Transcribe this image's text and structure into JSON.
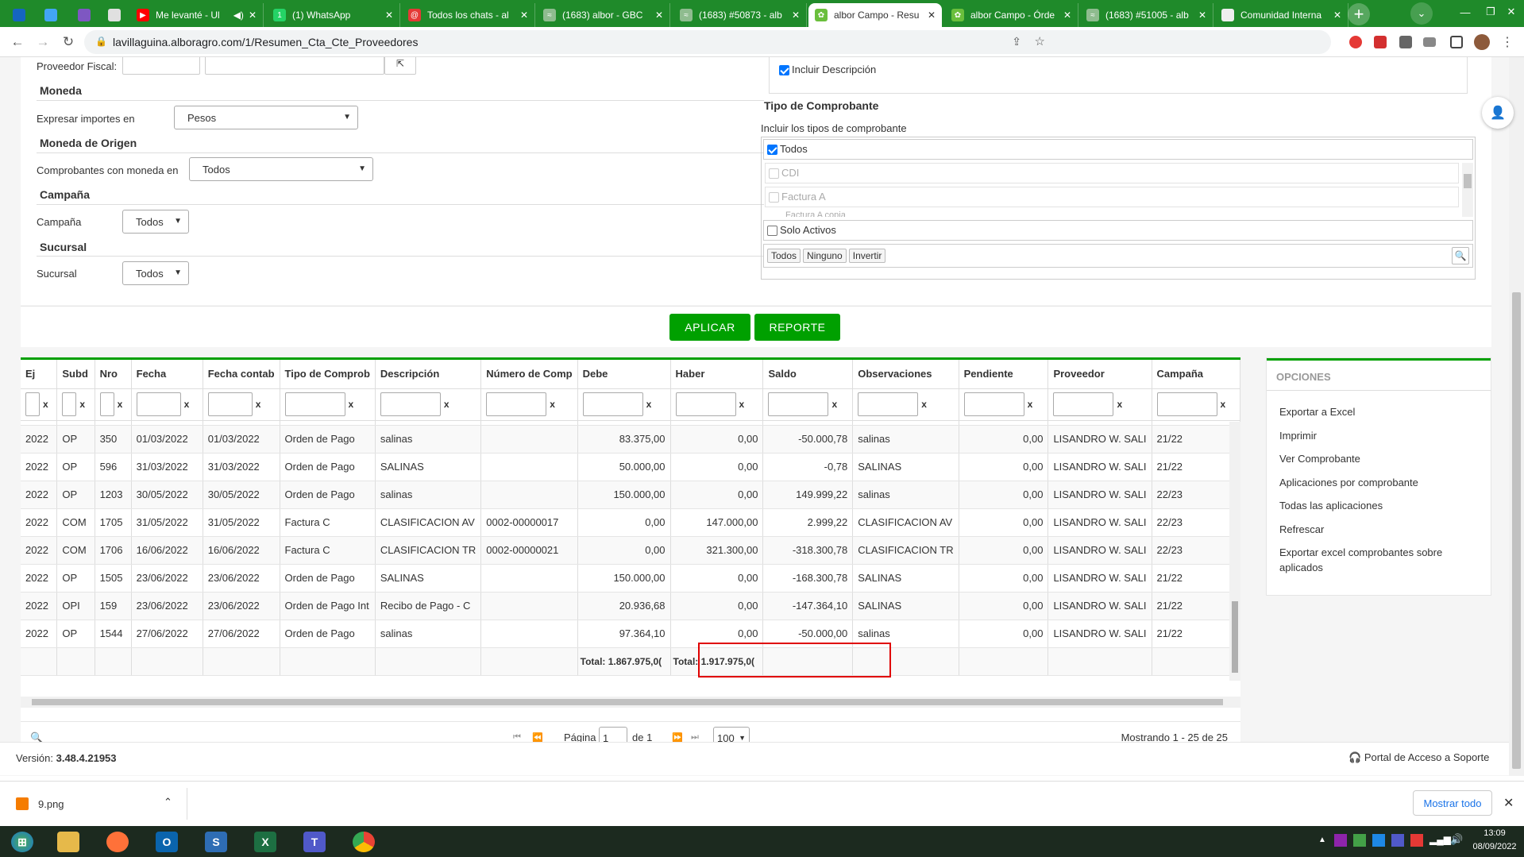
{
  "browser": {
    "tabs": [
      {
        "title": "Me levanté - Ul",
        "fav": "#ff0000",
        "glyph": "▶",
        "extra": "◀)"
      },
      {
        "title": "(1) WhatsApp",
        "fav": "#25d366",
        "glyph": "1"
      },
      {
        "title": "Todos los chats - al",
        "fav": "#e53935",
        "glyph": "@"
      },
      {
        "title": "(1683) albor - GBC",
        "fav": "#8fbc8f",
        "glyph": "≈"
      },
      {
        "title": "(1683) #50873 - alb",
        "fav": "#8fbc8f",
        "glyph": "≈"
      },
      {
        "title": "albor Campo - Resu",
        "fav": "#6abf3c",
        "glyph": "✿",
        "active": true
      },
      {
        "title": "albor Campo - Órde",
        "fav": "#6abf3c",
        "glyph": "✿"
      },
      {
        "title": "(1683) #51005 - alb",
        "fav": "#8fbc8f",
        "glyph": "≈"
      },
      {
        "title": "Comunidad Interna",
        "fav": "#eeeeee",
        "glyph": ""
      }
    ],
    "url": "lavillaguina.alboragro.com/1/Resumen_Cta_Cte_Proveedores"
  },
  "form": {
    "proveedor_fiscal_label": "Proveedor Fiscal:",
    "incluir_descripcion": "Incluir Descripción",
    "moneda_title": "Moneda",
    "expresar_label": "Expresar importes en",
    "expresar_value": "Pesos",
    "moneda_origen_title": "Moneda de Origen",
    "comprobantes_label": "Comprobantes con moneda en",
    "comprobantes_value": "Todos",
    "campana_title": "Campaña",
    "campana_label": "Campaña",
    "campana_value": "Todos",
    "sucursal_title": "Sucursal",
    "sucursal_label": "Sucursal",
    "sucursal_value": "Todos",
    "tipo_title": "Tipo de Comprobante",
    "tipo_subtitle": "Incluir los tipos de comprobante",
    "todos_check": "Todos",
    "tipo_options": [
      "CDI",
      "Factura A",
      "Factura A copia"
    ],
    "solo_activos": "Solo Activos",
    "btn_todos": "Todos",
    "btn_ninguno": "Ninguno",
    "btn_invertir": "Invertir",
    "aplicar": "APLICAR",
    "reporte": "REPORTE"
  },
  "grid": {
    "columns": [
      "Ej",
      "Subd",
      "Nro",
      "Fecha",
      "Fecha contab",
      "Tipo de Comprob",
      "Descripción",
      "Número de Comp",
      "Debe",
      "Haber",
      "Saldo",
      "Observaciones",
      "Pendiente",
      "Proveedor",
      "Campaña"
    ],
    "filter_x": "x",
    "rows": [
      [
        "2022",
        "OP",
        "350",
        "01/03/2022",
        "01/03/2022",
        "Orden de Pago",
        "salinas",
        "",
        "83.375,00",
        "0,00",
        "-50.000,78",
        "salinas",
        "0,00",
        "LISANDRO W. SALI",
        "21/22"
      ],
      [
        "2022",
        "OP",
        "596",
        "31/03/2022",
        "31/03/2022",
        "Orden de Pago",
        "SALINAS",
        "",
        "50.000,00",
        "0,00",
        "-0,78",
        "SALINAS",
        "0,00",
        "LISANDRO W. SALI",
        "21/22"
      ],
      [
        "2022",
        "OP",
        "1203",
        "30/05/2022",
        "30/05/2022",
        "Orden de Pago",
        "salinas",
        "",
        "150.000,00",
        "0,00",
        "149.999,22",
        "salinas",
        "0,00",
        "LISANDRO W. SALI",
        "22/23"
      ],
      [
        "2022",
        "COM",
        "1705",
        "31/05/2022",
        "31/05/2022",
        "Factura C",
        "CLASIFICACION AV",
        "0002-00000017",
        "0,00",
        "147.000,00",
        "2.999,22",
        "CLASIFICACION AV",
        "0,00",
        "LISANDRO W. SALI",
        "22/23"
      ],
      [
        "2022",
        "COM",
        "1706",
        "16/06/2022",
        "16/06/2022",
        "Factura C",
        "CLASIFICACION TR",
        "0002-00000021",
        "0,00",
        "321.300,00",
        "-318.300,78",
        "CLASIFICACION TR",
        "0,00",
        "LISANDRO W. SALI",
        "22/23"
      ],
      [
        "2022",
        "OP",
        "1505",
        "23/06/2022",
        "23/06/2022",
        "Orden de Pago",
        "SALINAS",
        "",
        "150.000,00",
        "0,00",
        "-168.300,78",
        "SALINAS",
        "0,00",
        "LISANDRO W. SALI",
        "21/22"
      ],
      [
        "2022",
        "OPI",
        "159",
        "23/06/2022",
        "23/06/2022",
        "Orden de Pago Int",
        "Recibo de Pago - C",
        "",
        "20.936,68",
        "0,00",
        "-147.364,10",
        "SALINAS",
        "0,00",
        "LISANDRO W. SALI",
        "21/22"
      ],
      [
        "2022",
        "OP",
        "1544",
        "27/06/2022",
        "27/06/2022",
        "Orden de Pago",
        "salinas",
        "",
        "97.364,10",
        "0,00",
        "-50.000,00",
        "salinas",
        "0,00",
        "LISANDRO W. SALI",
        "21/22"
      ]
    ],
    "total_debe": "Total: 1.867.975,0(",
    "total_haber": "Total: 1.917.975,0(",
    "pager_pagina": "Página",
    "pager_page": "1",
    "pager_de": "de 1",
    "pager_size": "100",
    "showing": "Mostrando 1 - 25 de 25"
  },
  "options": {
    "title": "OPCIONES",
    "items": [
      "Exportar a Excel",
      "Imprimir",
      "Ver Comprobante",
      "Aplicaciones por comprobante",
      "Todas las aplicaciones",
      "Refrescar",
      "Exportar excel comprobantes sobre aplicados"
    ]
  },
  "footer": {
    "version_label": "Versión:",
    "version_value": "3.48.4.21953",
    "portal": "Portal de Acceso a Soporte"
  },
  "downloads": {
    "file": "9.png",
    "show_all": "Mostrar todo"
  },
  "taskbar": {
    "time": "13:09",
    "date": "08/09/2022"
  },
  "colors": {
    "accent": "#00a000",
    "tabbar": "#1f8a2a",
    "highlight": "#e00000"
  }
}
